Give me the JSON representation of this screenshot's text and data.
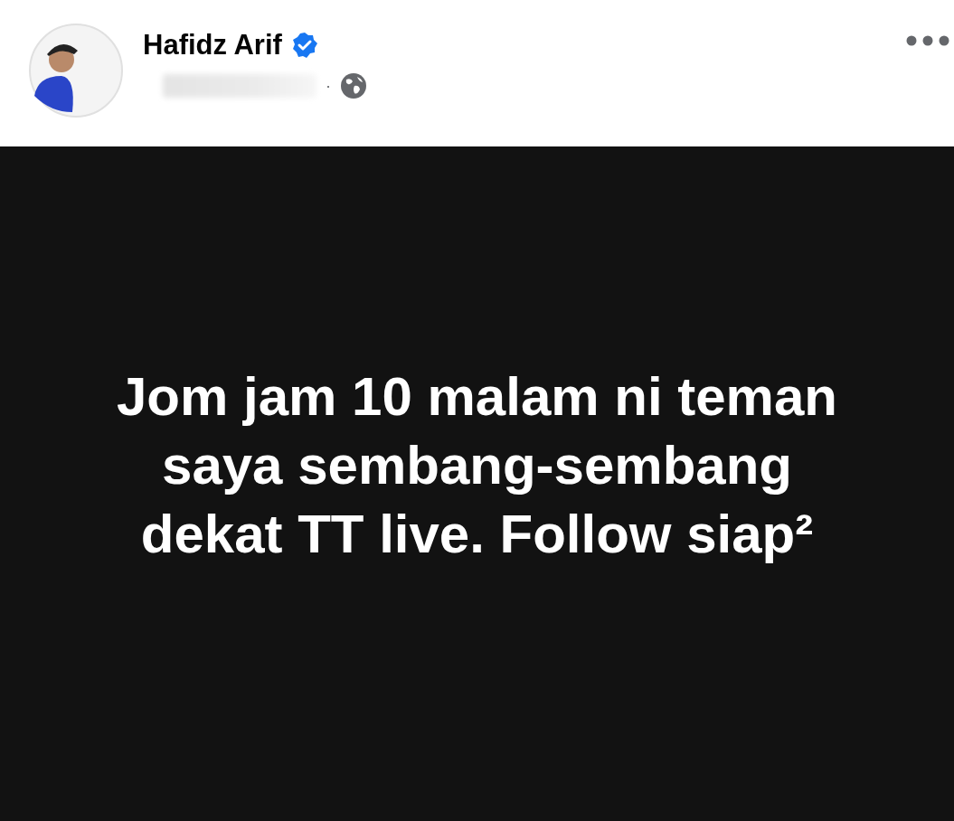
{
  "post": {
    "author": {
      "name": "Hafidz Arif",
      "verified": true
    },
    "meta": {
      "separator": "·",
      "timestamp_blurred": true
    },
    "text": "Jom jam 10 malam ni teman saya sembang-sembang dekat TT live. Follow siap²"
  }
}
